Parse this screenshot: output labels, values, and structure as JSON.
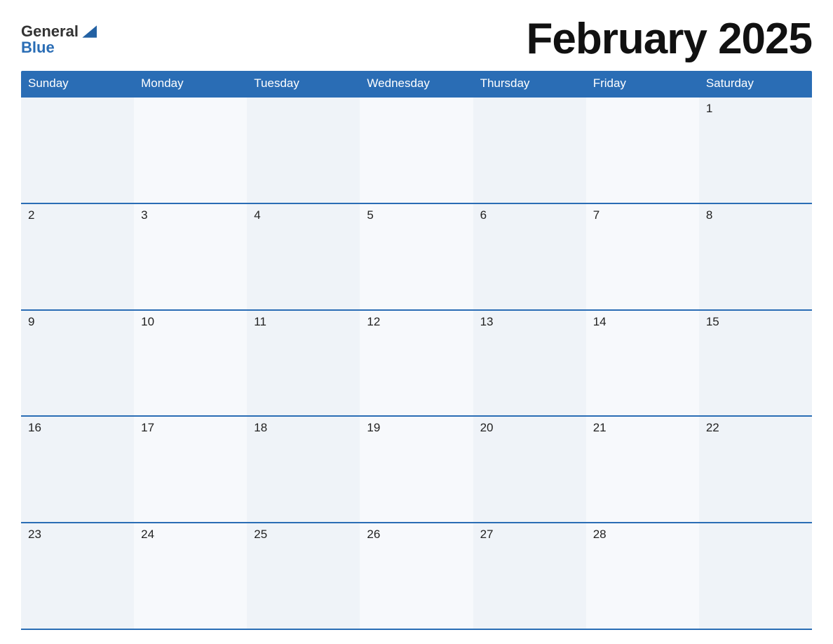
{
  "logo": {
    "general": "General",
    "blue": "Blue"
  },
  "title": "February 2025",
  "header": {
    "days": [
      "Sunday",
      "Monday",
      "Tuesday",
      "Wednesday",
      "Thursday",
      "Friday",
      "Saturday"
    ]
  },
  "weeks": [
    {
      "cells": [
        {
          "date": "",
          "empty": true
        },
        {
          "date": "",
          "empty": true
        },
        {
          "date": "",
          "empty": true
        },
        {
          "date": "",
          "empty": true
        },
        {
          "date": "",
          "empty": true
        },
        {
          "date": "",
          "empty": true
        },
        {
          "date": "1",
          "empty": false
        }
      ]
    },
    {
      "cells": [
        {
          "date": "2",
          "empty": false
        },
        {
          "date": "3",
          "empty": false
        },
        {
          "date": "4",
          "empty": false
        },
        {
          "date": "5",
          "empty": false
        },
        {
          "date": "6",
          "empty": false
        },
        {
          "date": "7",
          "empty": false
        },
        {
          "date": "8",
          "empty": false
        }
      ]
    },
    {
      "cells": [
        {
          "date": "9",
          "empty": false
        },
        {
          "date": "10",
          "empty": false
        },
        {
          "date": "11",
          "empty": false
        },
        {
          "date": "12",
          "empty": false
        },
        {
          "date": "13",
          "empty": false
        },
        {
          "date": "14",
          "empty": false
        },
        {
          "date": "15",
          "empty": false
        }
      ]
    },
    {
      "cells": [
        {
          "date": "16",
          "empty": false
        },
        {
          "date": "17",
          "empty": false
        },
        {
          "date": "18",
          "empty": false
        },
        {
          "date": "19",
          "empty": false
        },
        {
          "date": "20",
          "empty": false
        },
        {
          "date": "21",
          "empty": false
        },
        {
          "date": "22",
          "empty": false
        }
      ]
    },
    {
      "cells": [
        {
          "date": "23",
          "empty": false
        },
        {
          "date": "24",
          "empty": false
        },
        {
          "date": "25",
          "empty": false
        },
        {
          "date": "26",
          "empty": false
        },
        {
          "date": "27",
          "empty": false
        },
        {
          "date": "28",
          "empty": false
        },
        {
          "date": "",
          "empty": true
        }
      ]
    }
  ],
  "colors": {
    "header_bg": "#2a6db5",
    "header_text": "#ffffff",
    "cell_odd": "#eff3f8",
    "cell_even": "#f7f9fc",
    "border": "#2a6db5",
    "day_text": "#222222",
    "title_text": "#111111"
  }
}
